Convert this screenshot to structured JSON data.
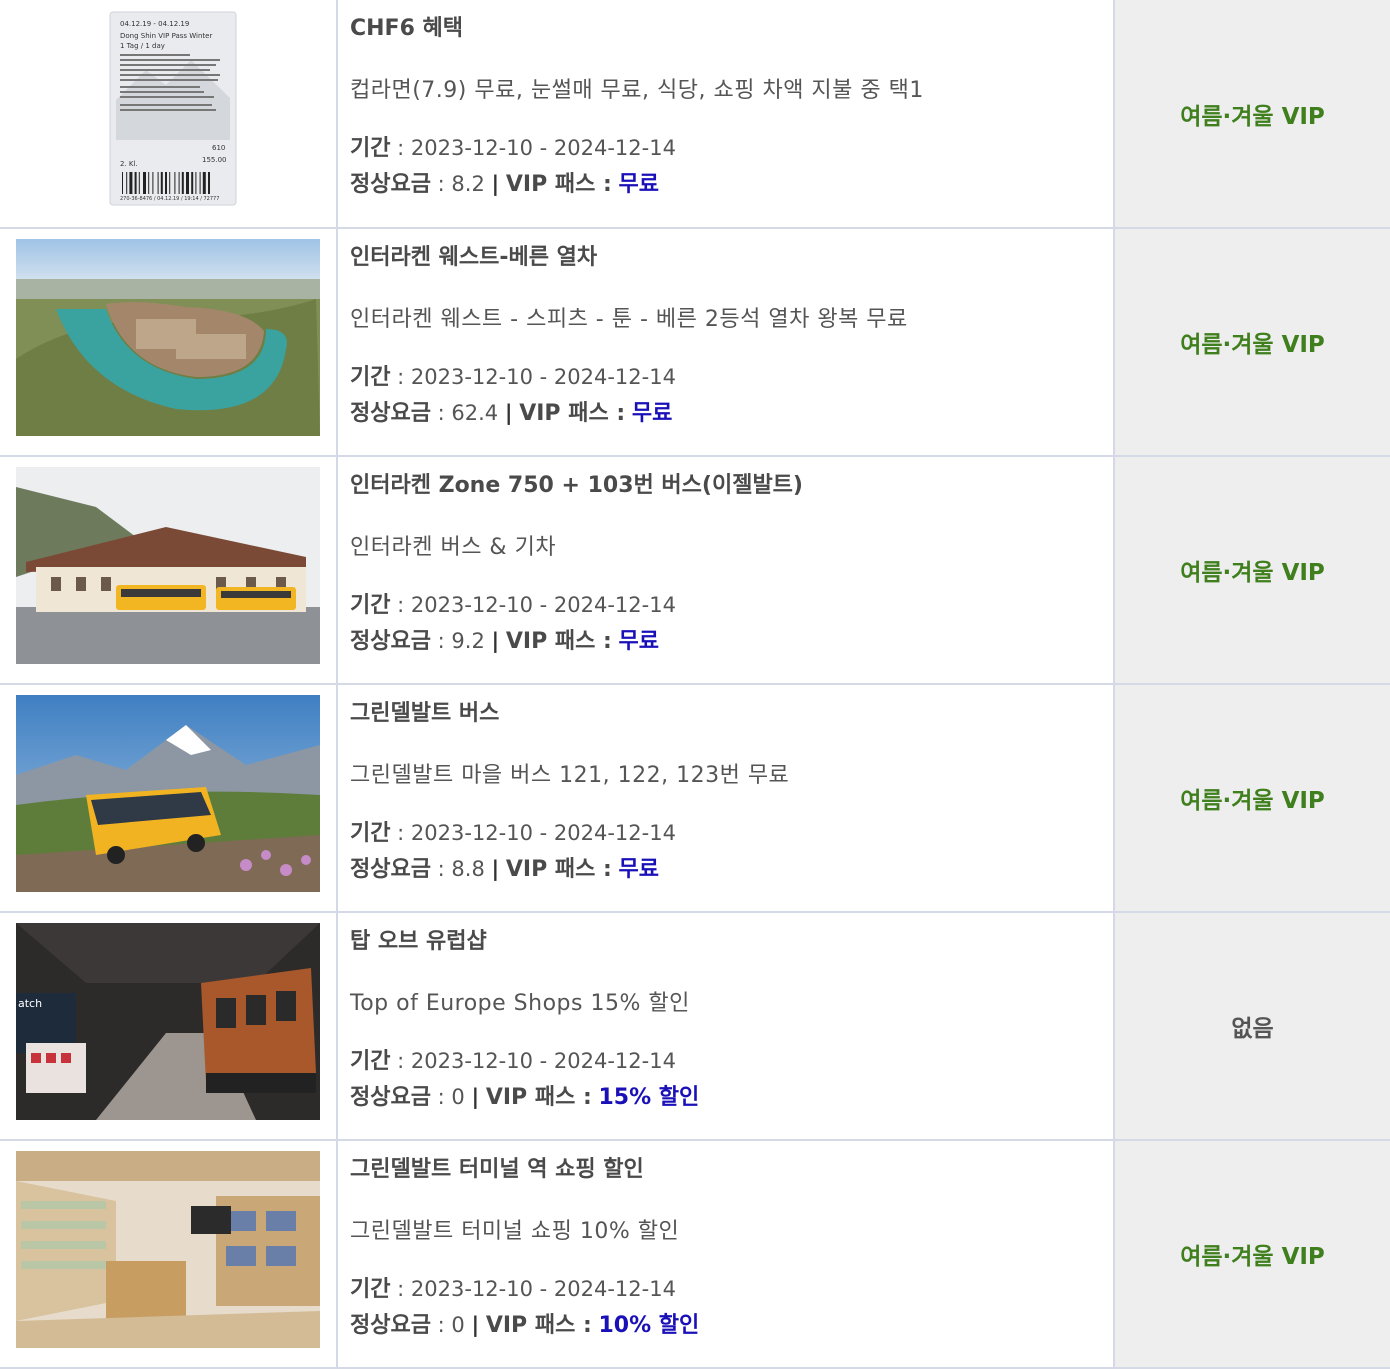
{
  "labels": {
    "period": "기간",
    "regular_price": "정상요금",
    "vip_pass": "VIP 패스 :",
    "sep": " : ",
    "range_sep": " - ",
    "pipe": "|"
  },
  "rows": [
    {
      "title": "CHF6 혜택",
      "description": "컵라면(7.9) 무료, 눈썰매 무료, 식당, 쇼핑 차액 지불 중 택1",
      "start": "2023-12-10",
      "end": "2024-12-14",
      "price": "8.2",
      "vip": "무료",
      "pass_type": "여름·겨울 VIP",
      "image": "vip-ticket"
    },
    {
      "title": "인터라켄 웨스트-베른 열차",
      "description": "인터라켄 웨스트 - 스피츠 - 툰 - 베른 2등석 열차 왕복 무료",
      "start": "2023-12-10",
      "end": "2024-12-14",
      "price": "62.4",
      "vip": "무료",
      "pass_type": "여름·겨울 VIP",
      "image": "bern-aerial"
    },
    {
      "title": "인터라켄 Zone 750 + 103번 버스(이젤발트)",
      "description": "인터라켄 버스 & 기차",
      "start": "2023-12-10",
      "end": "2024-12-14",
      "price": "9.2",
      "vip": "무료",
      "pass_type": "여름·겨울 VIP",
      "image": "interlaken-station"
    },
    {
      "title": "그린델발트 버스",
      "description": "그린델발트 마을 버스 121, 122, 123번 무료",
      "start": "2023-12-10",
      "end": "2024-12-14",
      "price": "8.8",
      "vip": "무료",
      "pass_type": "여름·겨울 VIP",
      "image": "grindelwald-bus"
    },
    {
      "title": "탑 오브 유럽샵",
      "description": "Top of Europe Shops 15% 할인",
      "start": "2023-12-10",
      "end": "2024-12-14",
      "price": "0",
      "vip": "15% 할인",
      "pass_type": "없음",
      "image": "top-of-europe-shop"
    },
    {
      "title": "그린델발트 터미널 역 쇼핑 할인",
      "description": "그린델발트 터미널 쇼핑 10% 할인",
      "start": "2023-12-10",
      "end": "2024-12-14",
      "price": "0",
      "vip": "10% 할인",
      "pass_type": "여름·겨울 VIP",
      "image": "terminal-shop"
    }
  ],
  "ticket": {
    "dates": "04.12.19 - 04.12.19",
    "name": "Dong Shin VIP Pass Winter",
    "days": "1 Tag / 1 day",
    "class": "2. Kl.",
    "code": "610",
    "amount": "155.00",
    "serial": "270-36-8476 / 04.12.19 / 19:14 / 72777"
  },
  "shop_sign": "atch"
}
